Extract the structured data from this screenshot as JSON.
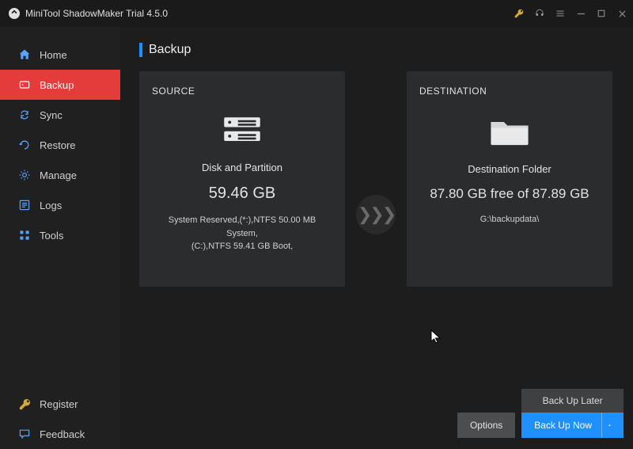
{
  "app": {
    "title": "MiniTool ShadowMaker Trial 4.5.0"
  },
  "nav": {
    "home": "Home",
    "backup": "Backup",
    "sync": "Sync",
    "restore": "Restore",
    "manage": "Manage",
    "logs": "Logs",
    "tools": "Tools",
    "register": "Register",
    "feedback": "Feedback"
  },
  "page": {
    "title": "Backup"
  },
  "source": {
    "head": "SOURCE",
    "label": "Disk and Partition",
    "size": "59.46 GB",
    "detail1": "System Reserved,(*:),NTFS 50.00 MB System,",
    "detail2": "(C:),NTFS 59.41 GB Boot,"
  },
  "destination": {
    "head": "DESTINATION",
    "label": "Destination Folder",
    "size": "87.80 GB free of 87.89 GB",
    "path": "G:\\backupdata\\"
  },
  "buttons": {
    "options": "Options",
    "backup_later": "Back Up Later",
    "backup_now": "Back Up Now"
  },
  "arrow": "❯❯❯"
}
